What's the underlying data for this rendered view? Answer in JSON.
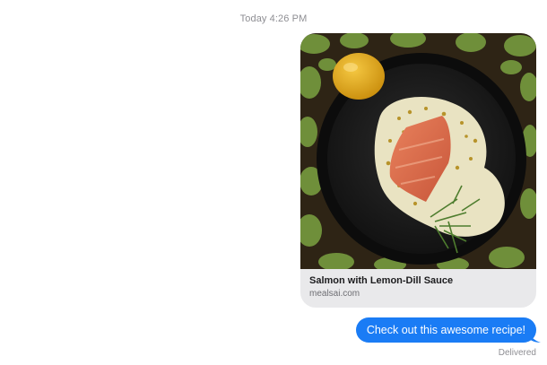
{
  "conversation": {
    "timestamp_day": "Today",
    "timestamp_time": "4:26 PM"
  },
  "link_preview": {
    "title": "Salmon with Lemon-Dill Sauce",
    "domain": "mealsai.com",
    "image_subject": "salmon-lemon-dill-photo"
  },
  "outgoing_message": {
    "text": "Check out this awesome recipe!",
    "status": "Delivered",
    "bubble_color": "#1a7cf5"
  }
}
